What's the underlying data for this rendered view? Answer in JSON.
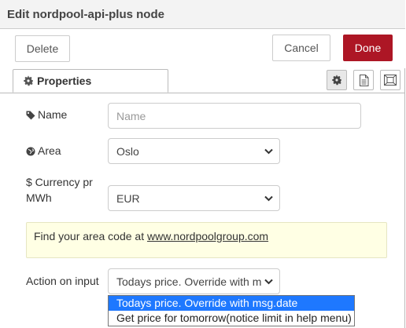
{
  "window": {
    "title": "Edit nordpool-api-plus node"
  },
  "toolbar": {
    "delete_label": "Delete",
    "cancel_label": "Cancel",
    "done_label": "Done"
  },
  "tabs": [
    {
      "label": "Properties",
      "icon": "gear-icon"
    }
  ],
  "tab_icons": [
    "gear-icon",
    "document-icon",
    "frame-icon"
  ],
  "form": {
    "name": {
      "label": "Name",
      "icon": "tag-icon",
      "value": "",
      "placeholder": "Name"
    },
    "area": {
      "label": "Area",
      "icon": "globe-icon",
      "value": "Oslo"
    },
    "currency": {
      "label": "$ Currency pr MWh",
      "label_line1": "$ Currency pr",
      "label_line2": "MWh",
      "value": "EUR"
    },
    "info": {
      "text": "Find your area code at ",
      "link": "www.nordpoolgroup.com"
    },
    "action": {
      "label": "Action on input",
      "value": "Todays price. Override with msg.date",
      "value_visible": "Todays price. Override with m",
      "options": [
        "Todays price. Override with msg.date",
        "Get price for tomorrow(notice limit in help menu)"
      ],
      "highlighted_index": 0
    }
  },
  "colors": {
    "done_button": "#ad1625",
    "info_bg": "#ffffe4",
    "option_highlight": "#1e78ff"
  }
}
